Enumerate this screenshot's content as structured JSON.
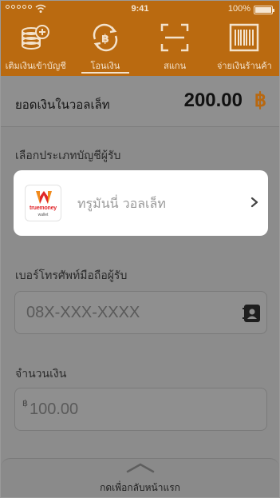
{
  "status_bar": {
    "time": "9:41",
    "battery": "100%"
  },
  "nav": {
    "items": [
      {
        "label": "เติมเงินเข้าบัญชี",
        "icon": "coins-plus-icon"
      },
      {
        "label": "โอนเงิน",
        "icon": "baht-transfer-icon",
        "active": true
      },
      {
        "label": "สแกน",
        "icon": "scan-frame-icon"
      },
      {
        "label": "จ่ายเงินร้านค้า",
        "icon": "barcode-icon"
      }
    ]
  },
  "balance": {
    "label": "ยอดเงินในวอลเล็ท",
    "amount": "200.00",
    "currency": "฿"
  },
  "recipient_type": {
    "label": "เลือกประเภทบัญชีผู้รับ",
    "selected": "ทรูมันนี่ วอลเล็ท",
    "logo_text": "truemoney",
    "logo_subtext": "wallet"
  },
  "phone": {
    "label": "เบอร์โทรศัพท์มือถือผู้รับ",
    "placeholder": "08X-XXX-XXXX"
  },
  "amount": {
    "label": "จำนวนเงิน",
    "currency": "฿",
    "placeholder": "100.00"
  },
  "bottom": {
    "label": "กดเพื่อกลับหน้าแรก"
  },
  "colors": {
    "brand": "#ba6a10",
    "overlay": "#8f8f8f",
    "card": "#ffffff"
  }
}
